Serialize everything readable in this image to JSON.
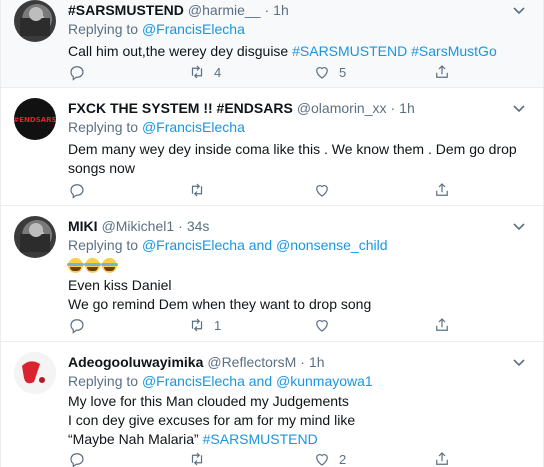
{
  "tweets": [
    {
      "name": "#SARSMUSTEND",
      "handle": "@harmie__",
      "dot": "·",
      "time": "1h",
      "replying_prefix": "Replying to ",
      "replying_mention1": "@FrancisElecha",
      "replying_and": "",
      "replying_mention2": "",
      "text_plain": "Call him out,the werey dey disguise ",
      "text_tag1": "#SARSMUSTEND",
      "text_tag2": " #SarsMustGo",
      "retweets": "4",
      "likes": "5"
    },
    {
      "name": "FXCK THE SYSTEM !! #ENDSARS",
      "handle": "@olamorin_xx",
      "dot": "·",
      "time": "1h",
      "avatar_text": "#ENDSARS",
      "replying_prefix": "Replying to ",
      "replying_mention1": "@FrancisElecha",
      "text_line1": "Dem many wey dey inside coma like this . We know them . Dem go drop",
      "text_line2": "songs now",
      "retweets": "",
      "likes": ""
    },
    {
      "name": "MIKI",
      "handle": "@Mikichel1",
      "dot": "·",
      "time": "34s",
      "replying_prefix": "Replying to ",
      "replying_mention1": "@FrancisElecha",
      "replying_and": " and ",
      "replying_mention2": "@nonsense_child",
      "text_line1": "Even kiss Daniel",
      "text_line2": "We go remind Dem when they want to drop song",
      "retweets": "1",
      "likes": ""
    },
    {
      "name": "Adeogooluwayimika",
      "handle": "@ReflectorsM",
      "dot": "·",
      "time": "1h",
      "replying_prefix": "Replying to ",
      "replying_mention1": "@FrancisElecha",
      "replying_and": " and ",
      "replying_mention2": "@kunmayowa1",
      "text_line1": "My love for this Man clouded my Judgements",
      "text_line2": "I con dey give excuses for am for my mind like",
      "text_line3_plain": "“Maybe Nah Malaria” ",
      "text_line3_tag": "#SARSMUSTEND",
      "retweets": "",
      "likes": "2"
    }
  ],
  "colors": {
    "accent": "#1b95e0",
    "secondary_text": "#5b7083",
    "highlight_bg": "#f7f9fa",
    "divider": "#ebeef0"
  },
  "icons": {
    "reply": "reply-icon",
    "retweet": "retweet-icon",
    "like": "heart-icon",
    "share": "share-icon",
    "more": "chevron-down-icon",
    "emoji": "face-with-tears-of-joy"
  }
}
